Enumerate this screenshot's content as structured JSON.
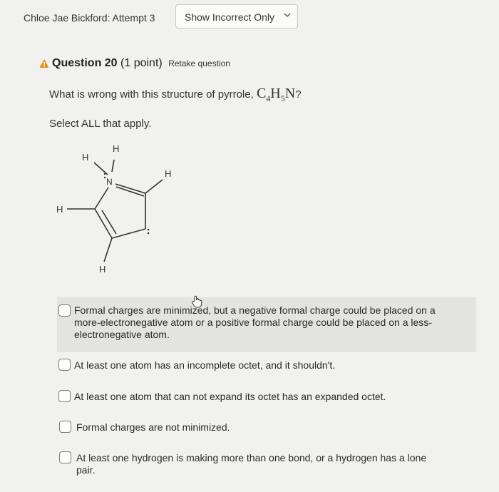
{
  "header": {
    "attempt_title": "Chloe Jae Bickford: Attempt 3",
    "filter": {
      "selected": "Show Incorrect Only"
    }
  },
  "question": {
    "title": "Question 20",
    "points": "(1 point)",
    "retake_label": "Retake question",
    "prompt_text": "What is wrong with this structure of pyrrole,",
    "formula": {
      "c": "C",
      "c_sub": "4",
      "h": "H",
      "h_sub": "5",
      "n": "N",
      "end": "?"
    },
    "instruction": "Select ALL that apply.",
    "structure": {
      "atoms": {
        "h_top": "H",
        "h_left_top": "H",
        "n": "N",
        "h_right": "H",
        "h_left": "H",
        "h_bottom": "H"
      }
    }
  },
  "options": [
    {
      "line1": "Formal charges are minimized, but a negative formal charge could be placed on a",
      "line2": "more-electronegative atom or a positive formal charge could be placed on a less-",
      "line3": "electronegative atom."
    },
    {
      "text": "At least one atom has an incomplete octet, and it shouldn't."
    },
    {
      "text": "At least one atom that can not expand its octet has an expanded octet."
    },
    {
      "text": "Formal charges are not minimized."
    },
    {
      "line1": "At least one hydrogen is making more than one bond, or a hydrogen has a lone",
      "line2": "pair."
    }
  ],
  "colors": {
    "warning": "#e88a1a",
    "highlight": "#e3e3e1",
    "background": "#f1f1ef"
  }
}
